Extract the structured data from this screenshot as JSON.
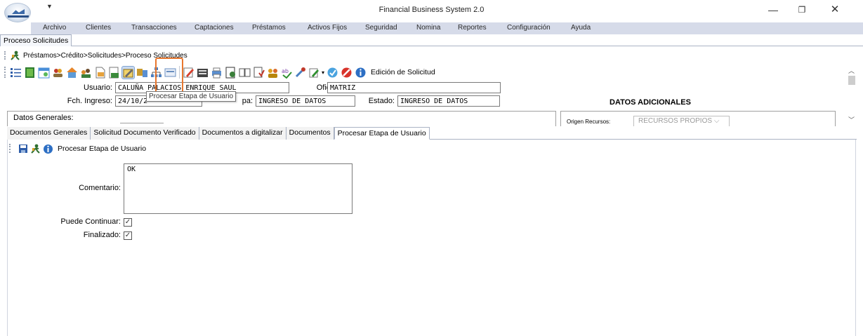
{
  "window": {
    "title": "Financial Business System 2.0",
    "minimize_glyph": "—",
    "maximize_glyph": "❐",
    "close_glyph": "✕",
    "quick_access_glyph": "▼"
  },
  "menu": [
    "Archivo",
    "Clientes",
    "Transacciones",
    "Captaciones",
    "Préstamos",
    "Activos Fijos",
    "Seguridad",
    "Nomina",
    "Reportes",
    "Configuración",
    "Ayuda"
  ],
  "document_tab": "Proceso Solicitudes",
  "breadcrumb": "Préstamos>Crédito>Solicitudes>Proceso Solicitudes",
  "toolbar": {
    "label": "Edición de Solicitud",
    "icons": [
      "list-icon",
      "book-icon",
      "calendar-icon",
      "users-icon",
      "home-icon",
      "people-icon",
      "document-icon",
      "report-icon",
      "edit-stage-icon",
      "org-icon",
      "hierarchy-icon",
      "form-icon",
      "edit-icon",
      "books-icon",
      "print-icon",
      "transfer-icon",
      "notebook-icon",
      "approve-icon",
      "group-icon",
      "spell-icon",
      "tools-icon",
      "edit-dropdown-icon",
      "refresh-icon",
      "cancel-icon",
      "info-icon"
    ]
  },
  "form": {
    "usuario_label": "Usuario:",
    "usuario_value": "CALUÑA PALACIOS ENRIQUE SAUL",
    "oficina_label": "Oficina:",
    "oficina_value": "MATRIZ",
    "fch_ingreso_label": "Fch. Ingreso:",
    "fch_ingreso_value": "24/10/2",
    "etapa_label": "pa:",
    "etapa_value": "INGRESO DE DATOS",
    "estado_label": "Estado:",
    "estado_value": "INGRESO DE DATOS",
    "datos_generales": "Datos Generales:",
    "datos_adicionales": "DATOS ADICIONALES",
    "origen_label": "Origen Recursos:",
    "origen_value": "RECURSOS PROPIOS"
  },
  "tooltip": "Procesar Etapa de Usuario",
  "tabs": [
    "Documentos Generales",
    "Solicitud Documento Verificado",
    "Documentos a digitalizar",
    "Documentos",
    "Procesar Etapa de Usuario"
  ],
  "active_tab_index": 4,
  "sub_toolbar": {
    "label": "Procesar Etapa de Usuario"
  },
  "process": {
    "comentario_label": "Comentario:",
    "comentario_value": "OK",
    "puede_continuar_label": "Puede Continuar:",
    "puede_continuar_checked": true,
    "finalizado_label": "Finalizado:",
    "finalizado_checked": true,
    "check_glyph": "✓"
  },
  "colors": {
    "menubar_bg": "#d6dbe9",
    "highlight": "#e8772e"
  }
}
